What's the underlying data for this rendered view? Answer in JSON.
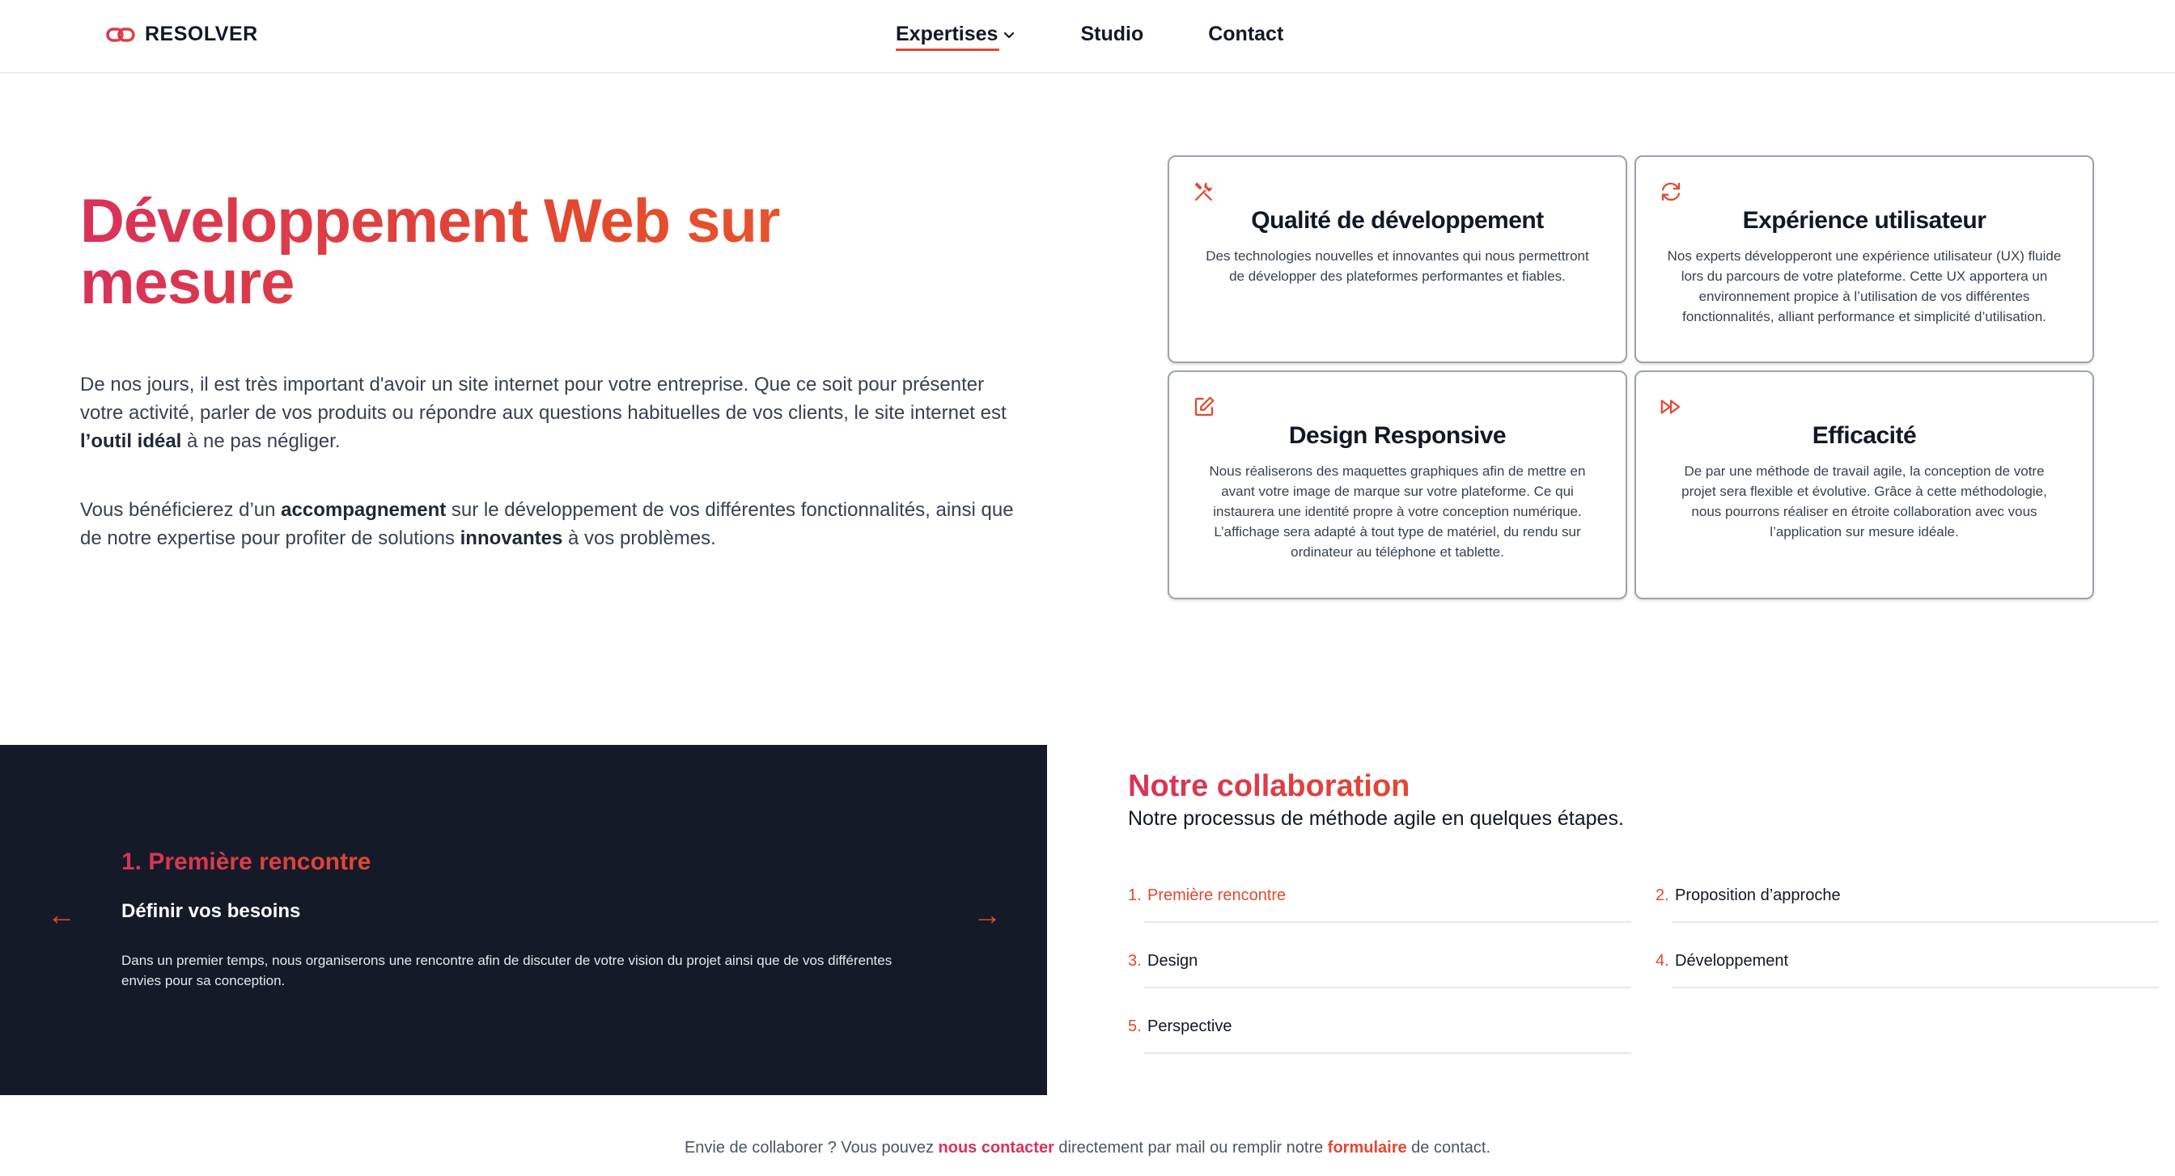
{
  "brand": {
    "name": "RESOLVER",
    "accent": "#e3482f",
    "accent_pink": "#d8325a",
    "dark_bg": "#141a27"
  },
  "nav": {
    "items": [
      {
        "label": "Expertises",
        "active": true,
        "icon": "chevron-down-icon"
      },
      {
        "label": "Studio"
      },
      {
        "label": "Contact"
      }
    ]
  },
  "hero": {
    "title": "Développement Web sur mesure",
    "p1": {
      "t1": "De nos jours, il est très important d'avoir un site internet pour votre entreprise. Que ce soit pour présenter votre activité, parler de vos produits ou répondre aux questions habituelles de vos clients, le site internet est ",
      "b1": "l’outil idéal",
      "t2": " à ne pas négliger."
    },
    "p2": {
      "t1": "Vous bénéficierez d’un ",
      "b1": "accompagnement",
      "t2": " sur le développement de vos différentes fonctionnalités, ainsi que de notre expertise pour profiter de solutions ",
      "b2": "innovantes",
      "t3": " à vos problèmes."
    }
  },
  "cards": [
    {
      "icon": "tools-icon",
      "title": "Qualité de développement",
      "text": "Des technologies nouvelles et innovantes qui nous permettront de développer des plateformes performantes et fiables."
    },
    {
      "icon": "refresh-icon",
      "title": "Expérience utilisateur",
      "text": "Nos experts développeront une expérience utilisateur (UX) fluide lors du parcours de votre plateforme. Cette UX apportera un environnement propice à l’utilisation de vos différentes fonctionnalités, alliant performance et simplicité d’utilisation."
    },
    {
      "icon": "edit-icon",
      "title": "Design Responsive",
      "text": "Nous réaliserons des maquettes graphiques afin de mettre en avant votre image de marque sur votre plateforme. Ce qui instaurera une identité propre à votre conception numérique. L’affichage sera adapté à tout type de matériel, du rendu sur ordinateur au téléphone et tablette."
    },
    {
      "icon": "fast-forward-icon",
      "title": "Efficacité",
      "text": "De par une méthode de travail agile, la conception de votre projet sera flexible et évolutive. Grâce à cette méthodologie, nous pourrons réaliser en étroite collaboration avec vous l’application sur mesure idéale."
    }
  ],
  "carousel": {
    "title": "1. Première rencontre",
    "subtitle": "Définir vos besoins",
    "description": "Dans un premier temps, nous organiserons une rencontre afin de discuter de votre vision du projet ainsi que de vos différentes envies pour sa conception.",
    "prev": "←",
    "next": "→"
  },
  "collab": {
    "title": "Notre collaboration",
    "subtitle": "Notre processus de méthode agile en quelques étapes.",
    "steps": [
      {
        "num": "1.",
        "label": "Première rencontre",
        "active": true
      },
      {
        "num": "2.",
        "label": "Proposition d’approche"
      },
      {
        "num": "3.",
        "label": "Design"
      },
      {
        "num": "4.",
        "label": "Développement"
      },
      {
        "num": "5.",
        "label": "Perspective"
      }
    ]
  },
  "footer": {
    "t1": "Envie de collaborer ? Vous pouvez ",
    "link1": "nous contacter",
    "t2": " directement par mail ou remplir notre ",
    "link2": "formulaire",
    "t3": " de contact."
  }
}
